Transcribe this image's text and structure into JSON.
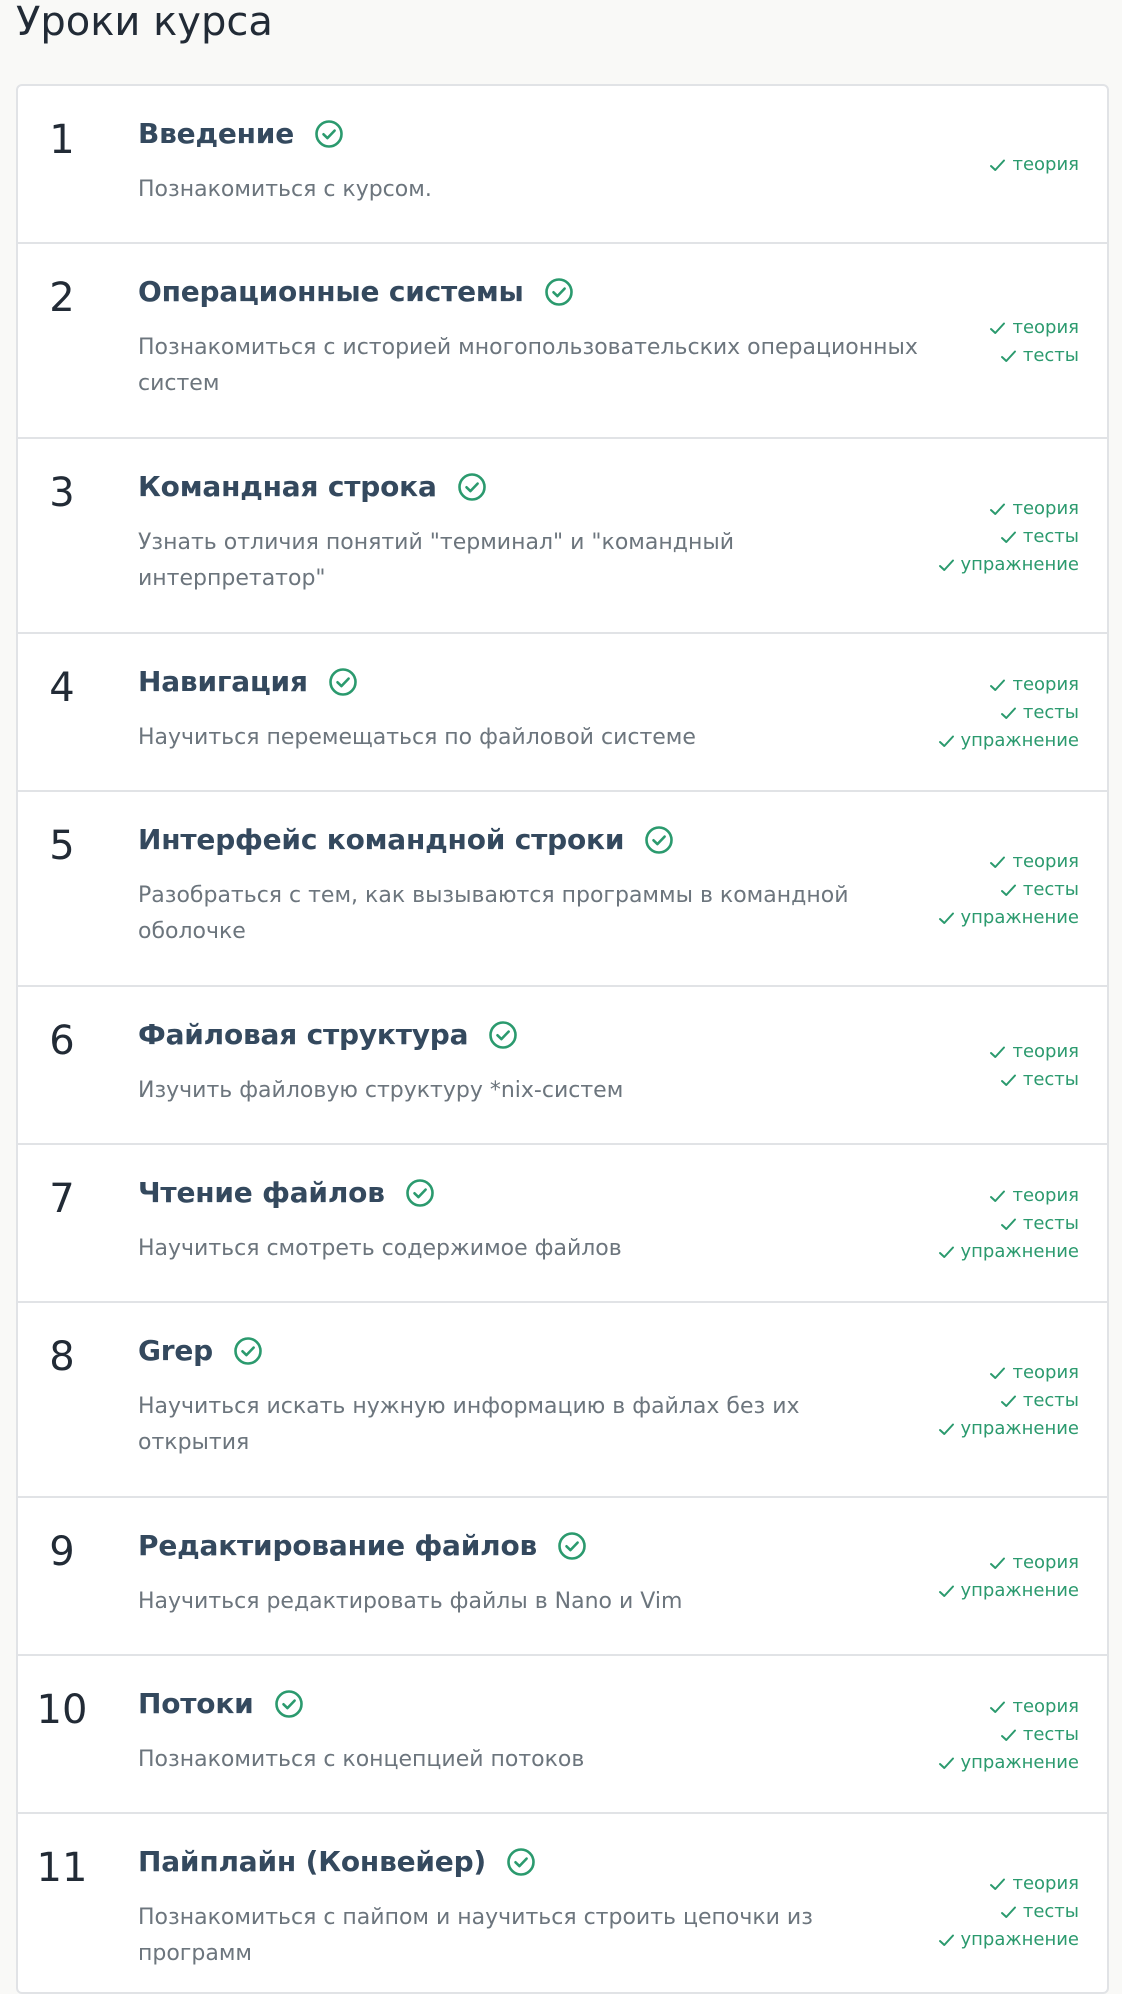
{
  "page": {
    "title": "Уроки курса"
  },
  "lessons": [
    {
      "number": "1",
      "title": "Введение",
      "description": "Познакомиться с курсом.",
      "progress": [
        "теория"
      ]
    },
    {
      "number": "2",
      "title": "Операционные системы",
      "description": "Познакомиться с историей многопользовательских операционных систем",
      "progress": [
        "теория",
        "тесты"
      ]
    },
    {
      "number": "3",
      "title": "Командная строка",
      "description": "Узнать отличия понятий \"терминал\" и \"командный интерпретатор\"",
      "progress": [
        "теория",
        "тесты",
        "упражнение"
      ]
    },
    {
      "number": "4",
      "title": "Навигация",
      "description": "Научиться перемещаться по файловой системе",
      "progress": [
        "теория",
        "тесты",
        "упражнение"
      ]
    },
    {
      "number": "5",
      "title": "Интерфейс командной строки",
      "description": "Разобраться с тем, как вызываются программы в командной оболочке",
      "progress": [
        "теория",
        "тесты",
        "упражнение"
      ]
    },
    {
      "number": "6",
      "title": "Файловая структура",
      "description": "Изучить файловую структуру *nix-систем",
      "progress": [
        "теория",
        "тесты"
      ]
    },
    {
      "number": "7",
      "title": "Чтение файлов",
      "description": "Научиться смотреть содержимое файлов",
      "progress": [
        "теория",
        "тесты",
        "упражнение"
      ]
    },
    {
      "number": "8",
      "title": "Grep",
      "description": "Научиться искать нужную информацию в файлах без их открытия",
      "progress": [
        "теория",
        "тесты",
        "упражнение"
      ]
    },
    {
      "number": "9",
      "title": "Редактирование файлов",
      "description": "Научиться редактировать файлы в Nano и Vim",
      "progress": [
        "теория",
        "упражнение"
      ]
    },
    {
      "number": "10",
      "title": "Потоки",
      "description": "Познакомиться с концепцией потоков",
      "progress": [
        "теория",
        "тесты",
        "упражнение"
      ]
    },
    {
      "number": "11",
      "title": "Пайплайн (Конвейер)",
      "description": "Познакомиться с пайпом и научиться строить цепочки из программ",
      "progress": [
        "теория",
        "тесты",
        "упражнение"
      ]
    }
  ],
  "icons": {
    "lesson_done": "check-circle-icon",
    "progress_item": "check-icon"
  },
  "colors": {
    "accent": "#2b9a6e",
    "title": "#34495e",
    "description": "#6c757d",
    "border": "#e1e3e6"
  }
}
